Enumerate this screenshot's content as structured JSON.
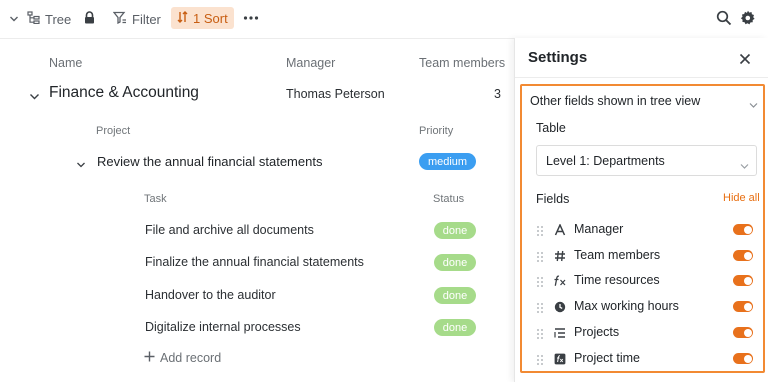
{
  "toolbar": {
    "tree_label": "Tree",
    "filter_label": "Filter",
    "sort_label": "1 Sort"
  },
  "table": {
    "columns": {
      "name": "Name",
      "manager": "Manager",
      "team_members": "Team members"
    },
    "group": {
      "name": "Finance & Accounting",
      "manager": "Thomas Peterson",
      "team_members": "3"
    },
    "project_columns": {
      "project": "Project",
      "priority": "Priority"
    },
    "project": {
      "name": "Review the annual financial statements",
      "priority": "medium"
    },
    "task_columns": {
      "task": "Task",
      "status": "Status"
    },
    "tasks": [
      {
        "name": "File and archive all documents",
        "status": "done"
      },
      {
        "name": "Finalize the annual financial statements",
        "status": "done"
      },
      {
        "name": "Handover to the auditor",
        "status": "done"
      },
      {
        "name": "Digitalize internal processes",
        "status": "done"
      }
    ],
    "add_record_label": "Add record"
  },
  "settings": {
    "title": "Settings",
    "section_title": "Other fields shown in tree view",
    "table_label": "Table",
    "table_select_value": "Level 1: Departments",
    "fields_label": "Fields",
    "hide_all_label": "Hide all",
    "fields": [
      {
        "label": "Manager",
        "icon": "text-icon",
        "enabled": true
      },
      {
        "label": "Team members",
        "icon": "hash-icon",
        "enabled": true
      },
      {
        "label": "Time resources",
        "icon": "formula-icon",
        "enabled": true
      },
      {
        "label": "Max working hours",
        "icon": "clock-icon",
        "enabled": true
      },
      {
        "label": "Projects",
        "icon": "list-icon",
        "enabled": true
      },
      {
        "label": "Project time",
        "icon": "formula-box-icon",
        "enabled": true
      }
    ]
  },
  "colors": {
    "accent": "#e8711c",
    "highlight_border": "#f28a33",
    "priority_medium": "#3b9ef1",
    "status_done": "#a6db8a"
  }
}
